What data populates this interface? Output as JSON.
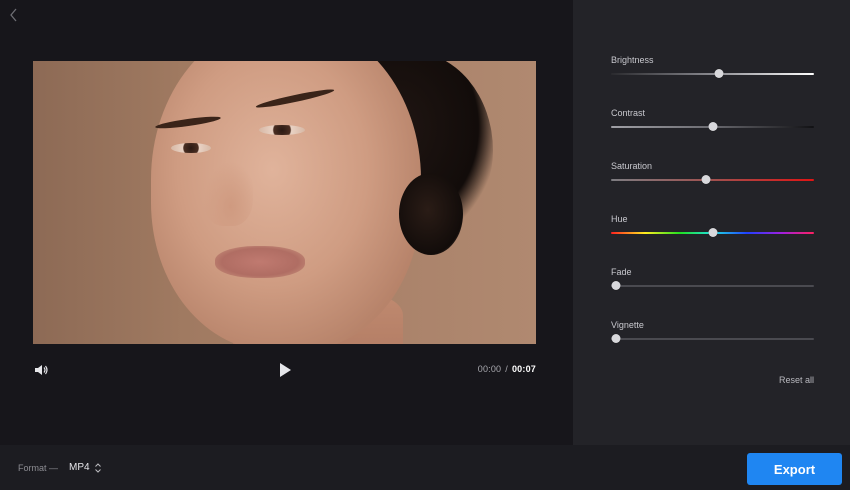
{
  "player": {
    "time_current": "00:00",
    "time_separator": "/",
    "time_total": "00:07",
    "video_alt": "portrait-video-frame"
  },
  "adjustments": [
    {
      "label": "Brightness",
      "value": 0.53,
      "track": "brightness"
    },
    {
      "label": "Contrast",
      "value": 0.5,
      "track": "contrast"
    },
    {
      "label": "Saturation",
      "value": 0.47,
      "track": "saturation"
    },
    {
      "label": "Hue",
      "value": 0.5,
      "track": "hue"
    },
    {
      "label": "Fade",
      "value": 0.0,
      "track": "neutral"
    },
    {
      "label": "Vignette",
      "value": 0.0,
      "track": "neutral"
    }
  ],
  "panel": {
    "reset_label": "Reset all"
  },
  "bottom": {
    "format_label": "Format —",
    "format_value": "MP4",
    "export_label": "Export"
  },
  "colors": {
    "accent": "#1f86f2",
    "panel_bg": "#232328",
    "main_bg": "#17161b"
  },
  "icons": {
    "back": "chevron-left-icon",
    "volume": "volume-icon",
    "play": "play-icon",
    "format_toggle": "sort-arrows-icon"
  }
}
